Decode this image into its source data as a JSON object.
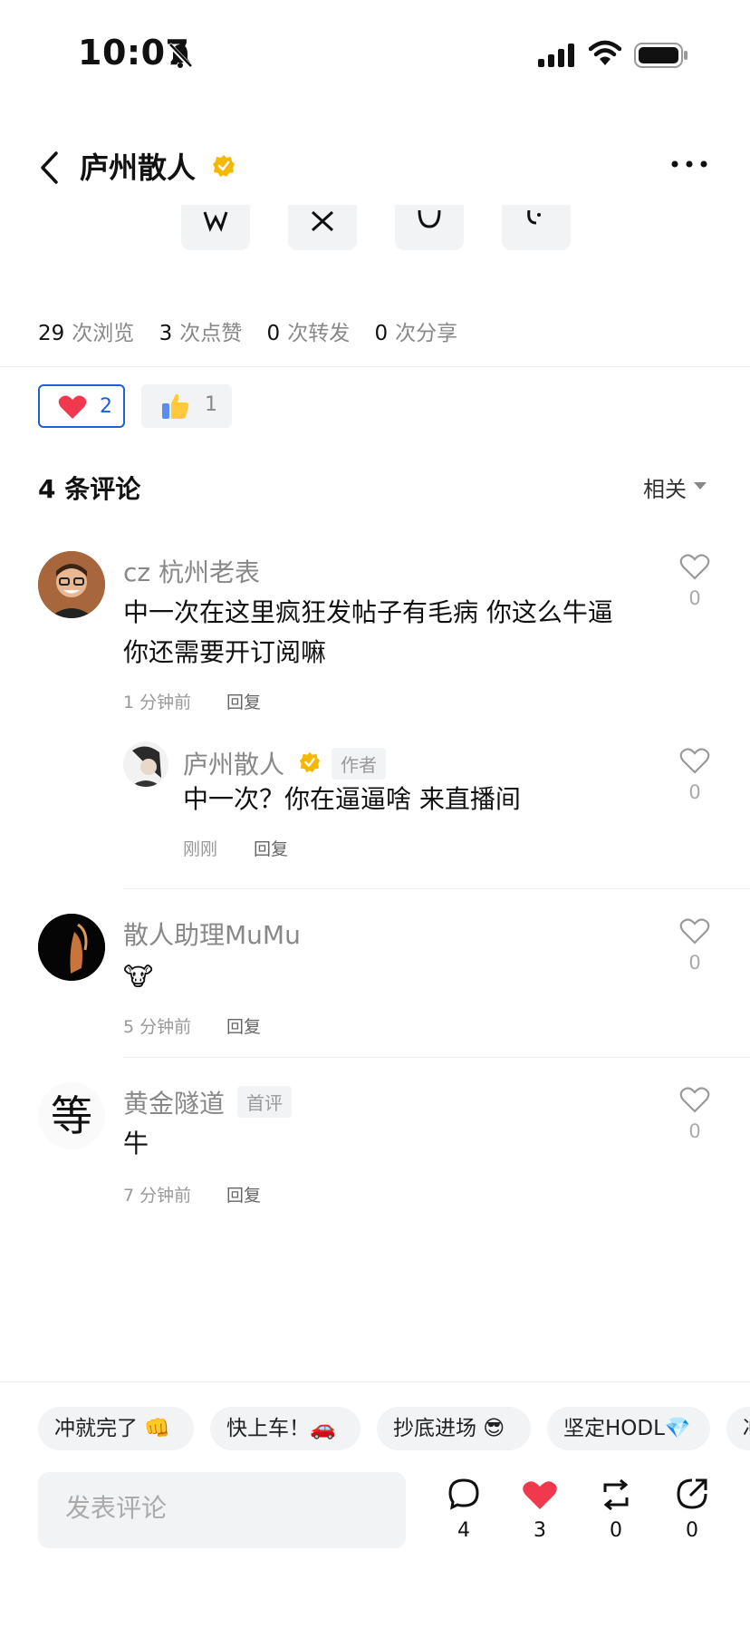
{
  "status": {
    "time": "10:07"
  },
  "header": {
    "title": "庐州散人"
  },
  "stats": {
    "views_num": "29",
    "views_label": "次浏览",
    "likes_num": "3",
    "likes_label": "次点赞",
    "reposts_num": "0",
    "reposts_label": "次转发",
    "shares_num": "0",
    "shares_label": "次分享"
  },
  "reactions": {
    "heart_count": "2",
    "thumbs_count": "1"
  },
  "comments_header": {
    "title": "4 条评论",
    "sort": "相关"
  },
  "comments": [
    {
      "name": "cz 杭州老表",
      "text_line1": "中一次在这里疯狂发帖子有毛病 你这么牛逼",
      "text_line2": "你还需要开订阅嘛",
      "time": "1 分钟前",
      "reply": "回复",
      "likes": "0"
    },
    {
      "name": "庐州散人",
      "tag": "作者",
      "text_line1": "中一次？你在逼逼啥 来直播间",
      "time": "刚刚",
      "reply": "回复",
      "likes": "0"
    },
    {
      "name": "散人助理MuMu",
      "text_line1": "🐮",
      "time": "5 分钟前",
      "reply": "回复",
      "likes": "0"
    },
    {
      "name": "黄金隧道",
      "tag": "首评",
      "text_line1": "牛",
      "time": "7 分钟前",
      "reply": "回复",
      "likes": "0",
      "avatar_glyph": "等"
    }
  ],
  "quick_replies": [
    "冲就完了 👊",
    "快上车！🚗",
    "抄底进场 😎",
    "坚定HODL💎",
    "冲"
  ],
  "composer": {
    "placeholder": "发表评论"
  },
  "actions": {
    "comments": "4",
    "likes": "3",
    "reposts": "0",
    "shares": "0"
  },
  "colors": {
    "accent_blue": "#1f5fd6",
    "heart_red": "#f0384f",
    "verified_gold": "#f5b800"
  }
}
